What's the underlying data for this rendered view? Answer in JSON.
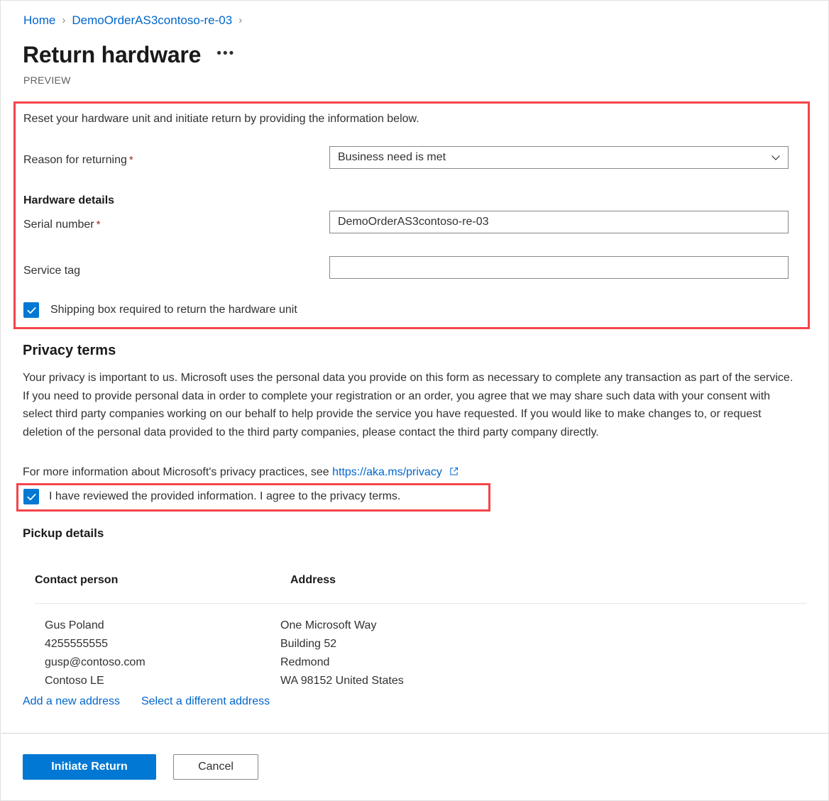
{
  "breadcrumb": {
    "items": [
      {
        "label": "Home"
      },
      {
        "label": "DemoOrderAS3contoso-re-03"
      }
    ],
    "separator": "›"
  },
  "header": {
    "title": "Return hardware",
    "more_menu": "•••",
    "preview_tag": "PREVIEW"
  },
  "form": {
    "intro": "Reset your hardware unit and initiate return by providing the information below.",
    "reason": {
      "label": "Reason for returning",
      "required_marker": "*",
      "value": "Business need is met"
    },
    "hardware_details_heading": "Hardware details",
    "serial_number": {
      "label": "Serial number",
      "required_marker": "*",
      "value": "DemoOrderAS3contoso-re-03",
      "placeholder": ""
    },
    "service_tag": {
      "label": "Service tag",
      "value": "",
      "placeholder": ""
    },
    "shipping_box": {
      "label": "Shipping box required to return the hardware unit",
      "checked": true
    }
  },
  "privacy": {
    "heading": "Privacy terms",
    "body": "Your privacy is important to us. Microsoft uses the personal data you provide on this form as necessary to complete any transaction as part of the service. If you need to provide personal data in order to complete your registration or an order, you agree that we may share such data with your consent with select third party companies working on our behalf to help provide the service you have requested. If you would like to make changes to, or request deletion of the personal data provided to the third party companies, please contact the third party company directly.",
    "more_info_prefix": "For more information about Microsoft's privacy practices, see",
    "link_text": "https://aka.ms/privacy",
    "agree": {
      "label": "I have reviewed the provided information. I agree to the privacy terms.",
      "checked": true
    }
  },
  "pickup": {
    "heading": "Pickup details",
    "columns": [
      "Contact person",
      "Address"
    ],
    "contact_person": [
      "Gus Poland",
      "4255555555",
      "gusp@contoso.com",
      "Contoso LE"
    ],
    "address": [
      "One Microsoft Way",
      "Building 52",
      "Redmond",
      "WA 98152 United States"
    ],
    "links": [
      {
        "label": "Add a new address"
      },
      {
        "label": "Select a different address"
      }
    ]
  },
  "footer": {
    "primary_button": "Initiate Return",
    "secondary_button": "Cancel"
  },
  "colors": {
    "accent": "#0078d4",
    "link": "#0066cc",
    "required": "#a4262c",
    "annotation": "#f4444a"
  }
}
